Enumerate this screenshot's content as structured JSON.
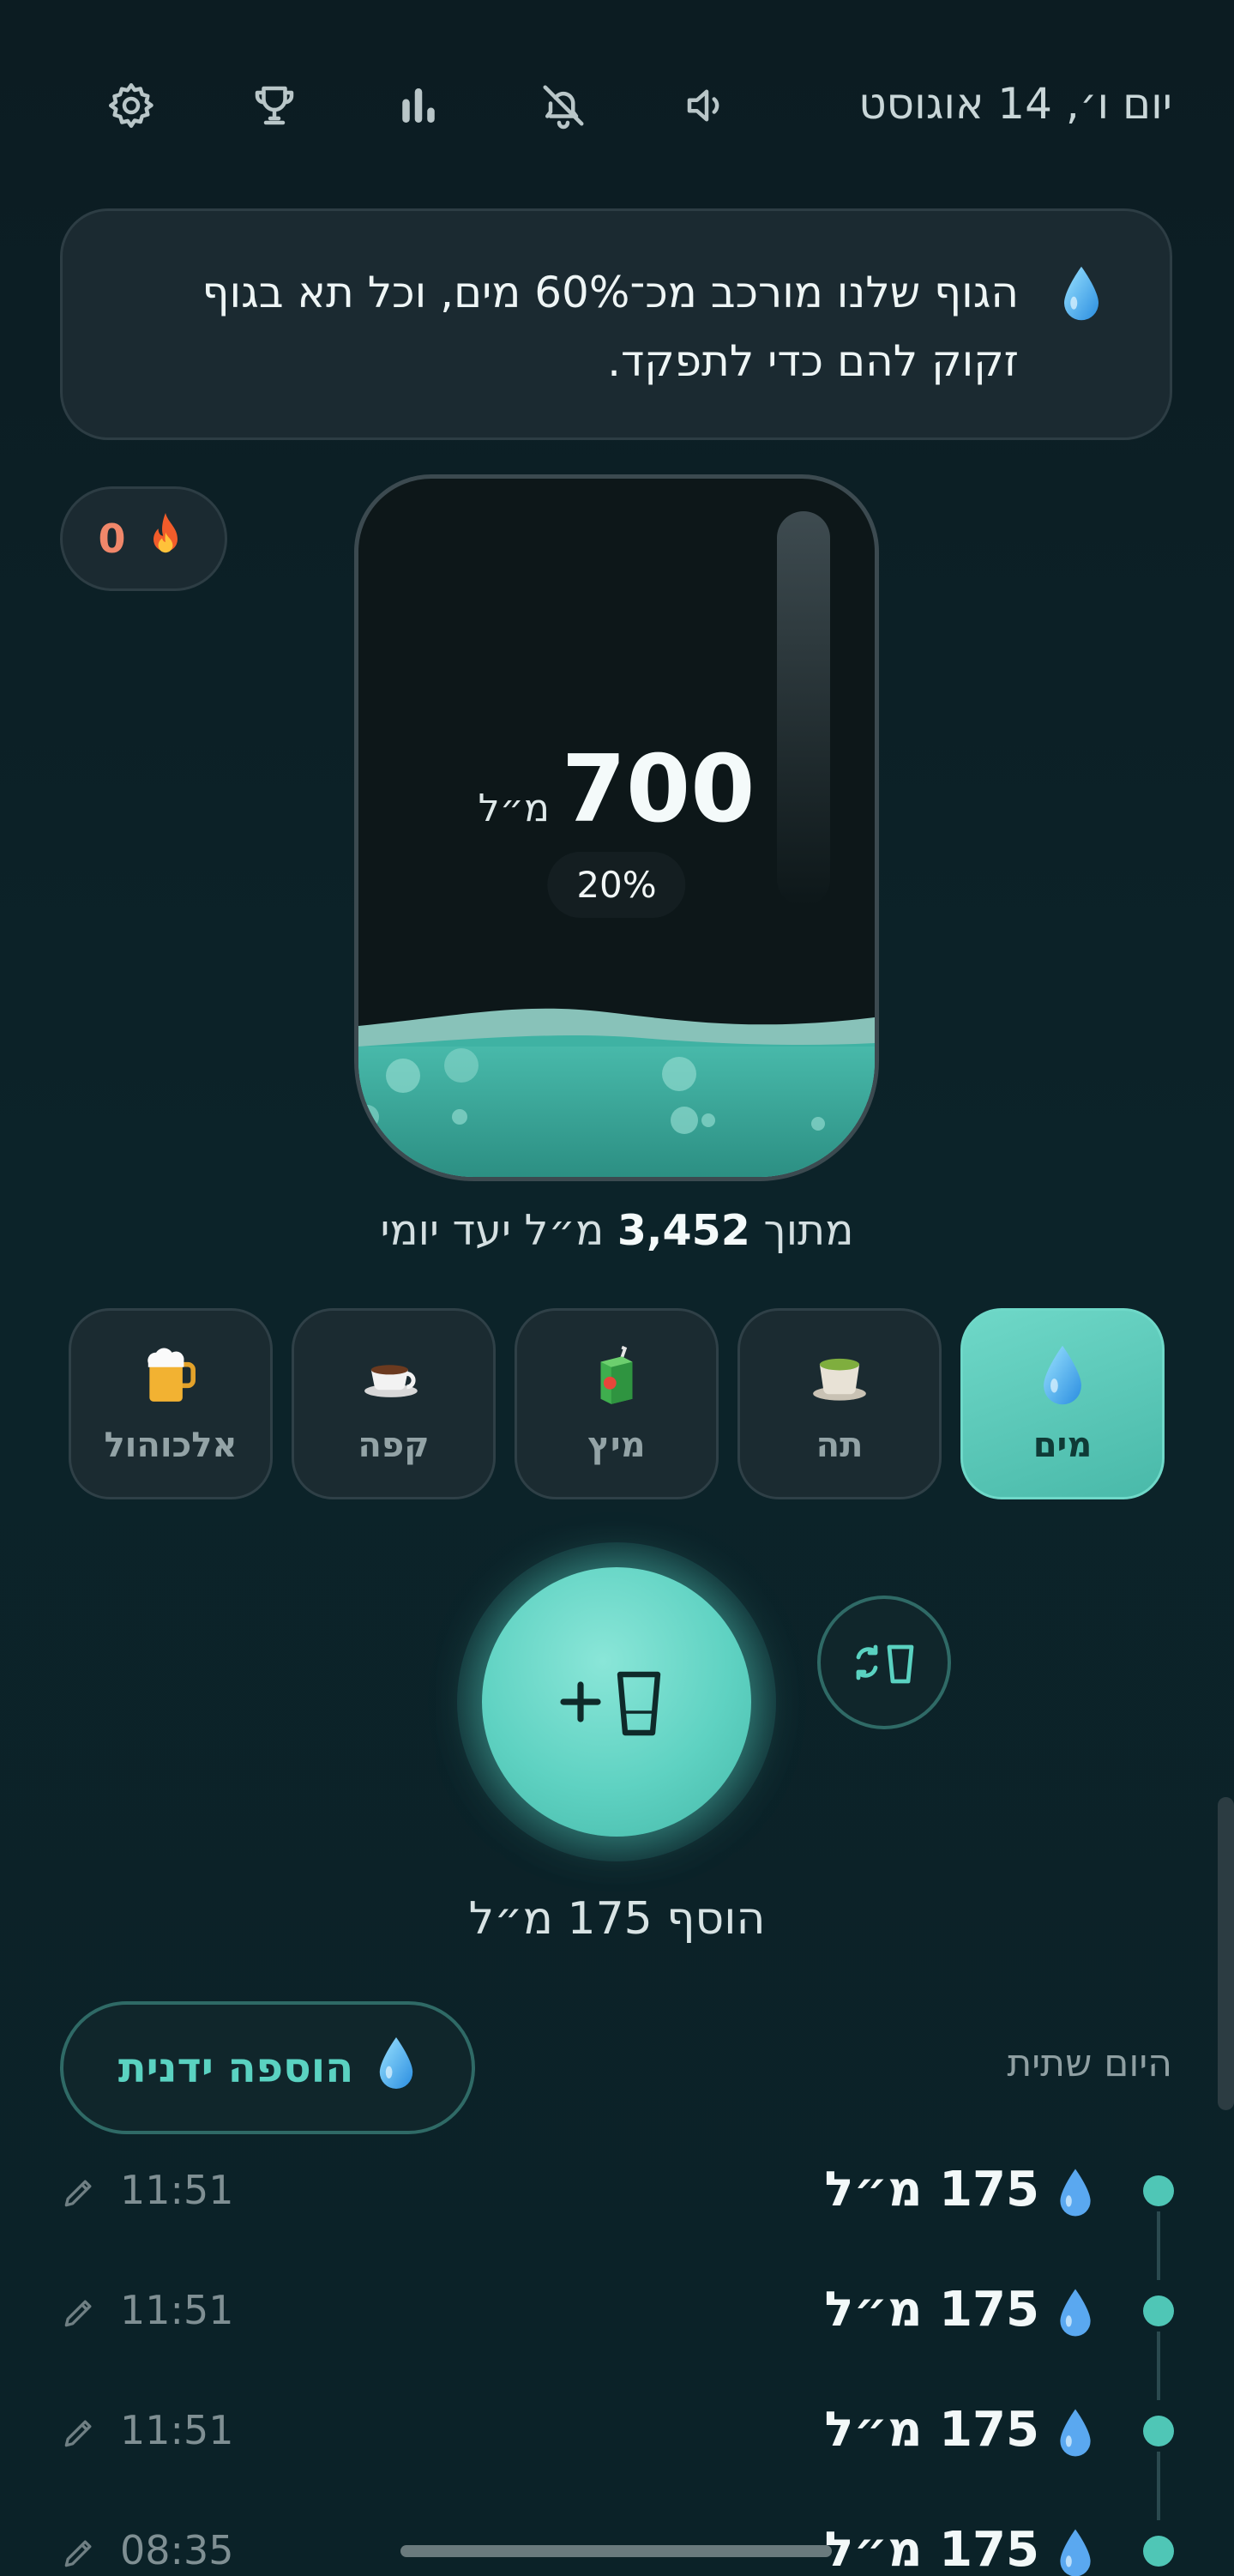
{
  "header": {
    "date": "יום ו׳, 14 אוגוסט",
    "icons": [
      "gear-icon",
      "trophy-icon",
      "stats-icon",
      "bell-off-icon",
      "volume-icon"
    ]
  },
  "tip": {
    "icon": "water-drop-icon",
    "line1": "הגוף שלנו מורכב מכ־60% מים, וכל תא בגוף",
    "line2": "זקוק להם כדי לתפקד."
  },
  "streak": {
    "count": "0",
    "icon": "fire-icon"
  },
  "progress": {
    "amount": "700",
    "unit": "מ״ל",
    "percent_label": "20%",
    "fraction": 0.2,
    "goal_prefix": "מתוך",
    "goal_value": "3,452",
    "goal_suffix": "מ״ל יעד יומי"
  },
  "drinks": [
    {
      "label": "מים",
      "icon": "water-drop-icon",
      "active": true
    },
    {
      "label": "תה",
      "icon": "tea-icon",
      "active": false
    },
    {
      "label": "מיץ",
      "icon": "juice-box-icon",
      "active": false
    },
    {
      "label": "קפה",
      "icon": "coffee-cup-icon",
      "active": false
    },
    {
      "label": "אלכוהול",
      "icon": "beer-mug-icon",
      "active": false
    }
  ],
  "add": {
    "label": "הוסף 175 מ״ל",
    "icon": "add-glass-icon",
    "swap_icon": "swap-cup-icon"
  },
  "history": {
    "title": "היום שתית",
    "manual_add_label": "הוספה ידנית",
    "entries": [
      {
        "volume": "175 מ״ל",
        "time": "11:51"
      },
      {
        "volume": "175 מ״ל",
        "time": "11:51"
      },
      {
        "volume": "175 מ״ל",
        "time": "11:51"
      },
      {
        "volume": "175 מ״ל",
        "time": "08:35"
      }
    ]
  },
  "colors": {
    "accent": "#5fd2c2",
    "background": "#0c2329",
    "card": "#1b2a31",
    "streak": "#f0876a"
  }
}
